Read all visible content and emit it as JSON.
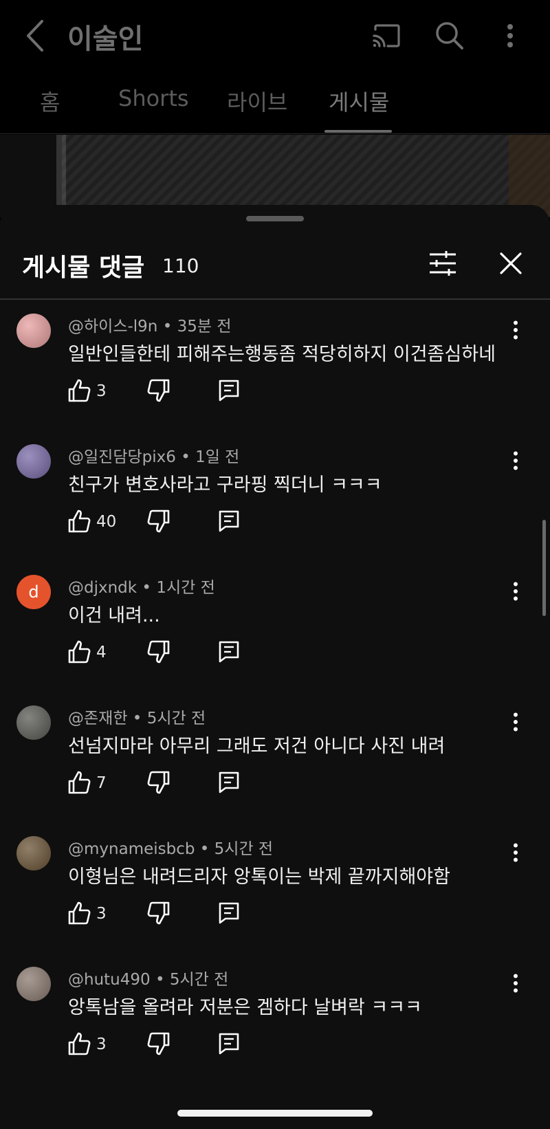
{
  "header": {
    "channel_title": "이술인",
    "tabs": [
      {
        "label": "홈"
      },
      {
        "label": "Shorts"
      },
      {
        "label": "라이브"
      },
      {
        "label": "게시물"
      }
    ],
    "active_tab": "게시물"
  },
  "comments_sheet": {
    "title": "게시물 댓글",
    "count": "110"
  },
  "comments": [
    {
      "author": "@하이스-l9n",
      "time": "35분 전",
      "text": "일반인들한테 피해주는행동좀 적당히하지 이건좀심하네",
      "likes": "3",
      "avatar": {
        "type": "image",
        "color": "#e8a0a0"
      }
    },
    {
      "author": "@일진담당pix6",
      "time": "1일 전",
      "text": "친구가 변호사라고 구라핑 찍더니 ㅋㅋㅋ",
      "likes": "40",
      "avatar": {
        "type": "image",
        "color": "#7a6aa8"
      }
    },
    {
      "author": "@djxndk",
      "time": "1시간 전",
      "text": "이건 내려...",
      "likes": "4",
      "avatar": {
        "type": "letter",
        "letter": "d",
        "color": "#e5532d"
      }
    },
    {
      "author": "@존재한",
      "time": "5시간 전",
      "text": "선넘지마라 아무리 그래도 저건 아니다 사진 내려",
      "likes": "7",
      "avatar": {
        "type": "image",
        "color": "#5a5a55"
      }
    },
    {
      "author": "@mynameisbcb",
      "time": "5시간 전",
      "text": "이형님은 내려드리자 앙톡이는 박제 끝까지해야함",
      "likes": "3",
      "avatar": {
        "type": "image",
        "color": "#6b5436"
      }
    },
    {
      "author": "@hutu490",
      "time": "5시간 전",
      "text": "앙톡남을 올려라 저분은 겜하다 날벼락 ㅋㅋㅋ",
      "likes": "3",
      "avatar": {
        "type": "image",
        "color": "#8a7a70"
      }
    }
  ],
  "icons": {
    "back": "arrow-back-icon",
    "cast": "cast-icon",
    "search": "search-icon",
    "more": "more-vert-icon",
    "filter": "tune-icon",
    "close": "close-icon",
    "like": "thumb-up-icon",
    "dislike": "thumb-down-icon",
    "reply": "comment-icon"
  },
  "colors": {
    "sheet_bg": "#0f0f0f",
    "text_primary": "#f1f1f1",
    "text_secondary": "#aaaaaa"
  }
}
